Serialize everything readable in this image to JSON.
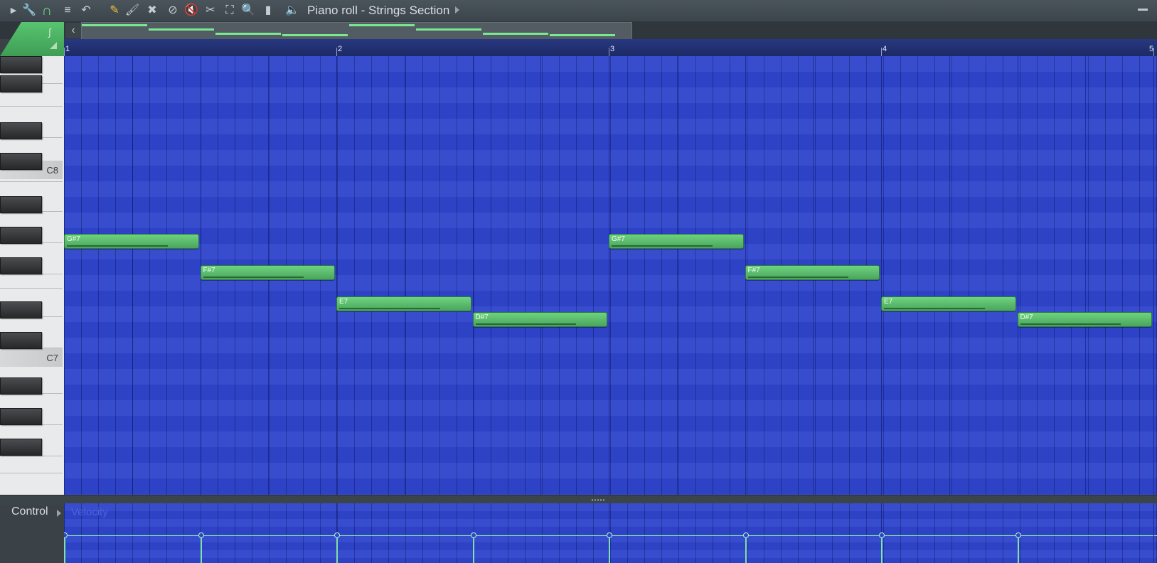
{
  "window": {
    "title": "Piano roll - Strings Section"
  },
  "toolbar": {
    "tools": [
      {
        "name": "play-arrow-icon",
        "glyph": "▶"
      },
      {
        "name": "wrench-icon",
        "glyph": "🔧"
      },
      {
        "name": "magnet-icon",
        "glyph": "∩"
      },
      {
        "name": "menu-circle-icon",
        "glyph": "≡"
      },
      {
        "name": "undo-icon",
        "glyph": "↶"
      },
      {
        "name": "pencil-icon",
        "glyph": "✎"
      },
      {
        "name": "brush-icon",
        "glyph": "🖌"
      },
      {
        "name": "delete-icon",
        "glyph": "✖"
      },
      {
        "name": "no-entry-icon",
        "glyph": "⊘"
      },
      {
        "name": "mute-icon",
        "glyph": "🔇"
      },
      {
        "name": "slice-icon",
        "glyph": "✂"
      },
      {
        "name": "select-icon",
        "glyph": "⛶"
      },
      {
        "name": "zoom-icon",
        "glyph": "🔍"
      },
      {
        "name": "playback-icon",
        "glyph": "▮"
      },
      {
        "name": "speaker-icon",
        "glyph": "🔈"
      }
    ]
  },
  "ruler": {
    "bars": [
      "1",
      "2",
      "3",
      "4",
      "5"
    ]
  },
  "keyboard": {
    "labels": [
      "C8",
      "C7"
    ]
  },
  "notes": [
    {
      "label": "G#7",
      "start": 0.0,
      "length": 0.5,
      "row": 11
    },
    {
      "label": "F#7",
      "start": 0.5,
      "length": 0.5,
      "row": 13
    },
    {
      "label": "E7",
      "start": 1.0,
      "length": 0.5,
      "row": 15
    },
    {
      "label": "D#7",
      "start": 1.5,
      "length": 0.5,
      "row": 16
    },
    {
      "label": "G#7",
      "start": 2.0,
      "length": 0.5,
      "row": 11
    },
    {
      "label": "F#7",
      "start": 2.5,
      "length": 0.5,
      "row": 13
    },
    {
      "label": "E7",
      "start": 3.0,
      "length": 0.5,
      "row": 15
    },
    {
      "label": "D#7",
      "start": 3.5,
      "length": 0.5,
      "row": 16
    }
  ],
  "control": {
    "label": "Control",
    "lane_name": "Velocity",
    "velocity_level": 0.78
  },
  "colors": {
    "grid": "#2f44cc",
    "note": "#5fbf70",
    "accent": "#4fb565",
    "velocity": "#7fe0a8"
  }
}
